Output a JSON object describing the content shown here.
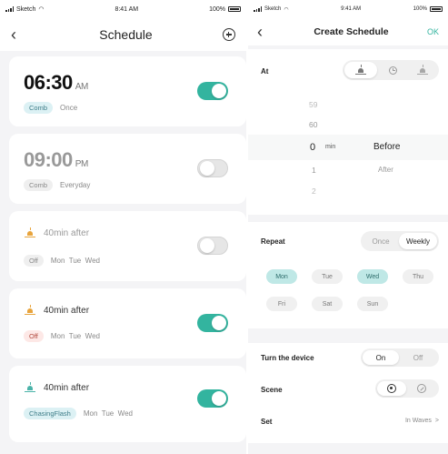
{
  "left_screen": {
    "status": {
      "carrier": "Sketch",
      "time": "8:41 AM",
      "battery": "100%"
    },
    "nav": {
      "back": "‹",
      "title": "Schedule"
    },
    "cards": [
      {
        "time": "06:30",
        "ampm": "AM",
        "tag": "Comb",
        "repeat": "Once",
        "enabled": true
      },
      {
        "time": "09:00",
        "ampm": "PM",
        "tag": "Comb",
        "repeat": "Everyday",
        "enabled": false
      },
      {
        "label": "40min after",
        "tag": "Off",
        "days": "Mon  Tue  Wed",
        "icon": "sunrise-icon",
        "enabled": false
      },
      {
        "label": "40min after",
        "tag": "Off",
        "days": "Mon  Tue  Wed",
        "icon": "sunrise-icon",
        "enabled": true
      },
      {
        "label": "40min after",
        "tag": "ChasingFlash",
        "days": "Mon  Tue  Wed",
        "icon": "sunset-icon",
        "enabled": true
      }
    ]
  },
  "right_screen": {
    "status": {
      "carrier": "Sketch",
      "time": "9:41 AM",
      "battery": "100%"
    },
    "nav": {
      "back": "‹",
      "title": "Create Schedule",
      "ok": "OK"
    },
    "at": {
      "label": "At",
      "picker_numbers": [
        "59",
        "60",
        "0",
        "1",
        "2"
      ],
      "selected_unit": "min",
      "options": [
        "Before",
        "After"
      ],
      "selected_option": "Before"
    },
    "repeat": {
      "label": "Repeat",
      "modes": [
        "Once",
        "Weekly"
      ],
      "selected_mode": "Weekly",
      "days": [
        "Mon",
        "Tue",
        "Wed",
        "Thu",
        "Fri",
        "Sat",
        "Sun"
      ],
      "selected_days": [
        "Mon",
        "Wed"
      ]
    },
    "device": {
      "label": "Turn the device",
      "on": "On",
      "off": "Off"
    },
    "scene": {
      "label": "Scene"
    },
    "set": {
      "label": "Set",
      "value": "In Waves",
      "chevron": ">"
    }
  },
  "colors": {
    "accent": "#33b49f",
    "sun_orange": "#e8a43c",
    "sun_teal": "#4bb3a9"
  }
}
